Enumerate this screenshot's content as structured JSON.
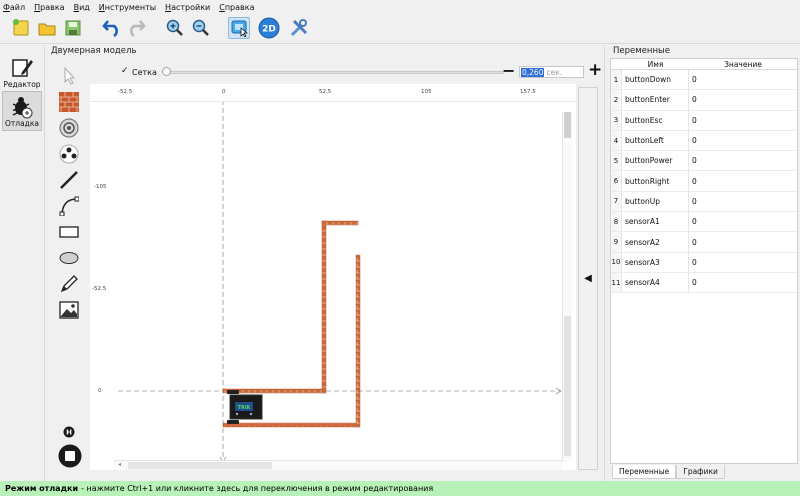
{
  "menu": [
    {
      "underline": "Ф",
      "rest": "айл"
    },
    {
      "underline": "П",
      "rest": "равка"
    },
    {
      "underline": "В",
      "rest": "ид"
    },
    {
      "underline": "И",
      "rest": "нструменты"
    },
    {
      "underline": "Н",
      "rest": "астройки"
    },
    {
      "underline": "С",
      "rest": "правка"
    }
  ],
  "toolbar": {
    "icons": [
      "new-file-icon",
      "open-folder-icon",
      "save-icon",
      "undo-icon",
      "redo-icon",
      "zoom-in-icon",
      "zoom-out-icon",
      "run-mode-icon",
      "view-2d-icon",
      "settings-tools-icon"
    ],
    "view_2d_label": "2D"
  },
  "modes": {
    "editor": "Редактор",
    "debug": "Отладка"
  },
  "scene": {
    "title": "Двумерная модель",
    "grid_label": "Сетка",
    "grid_checked": "✓",
    "minus": "−",
    "plus": "+",
    "time_value": "0,260",
    "time_unit": "сек.",
    "ruler_x": [
      "-52.5",
      "0",
      "52.5",
      "105",
      "157.5"
    ],
    "ruler_y": [
      "-105",
      "-52.5",
      "0"
    ],
    "robot_label": "TRIK"
  },
  "palette": [
    "cursor-icon",
    "wall-icon",
    "skittle-icon",
    "ball-icon",
    "line-icon",
    "bezier-icon",
    "rectangle-icon",
    "ellipse-icon",
    "pencil-icon",
    "image-icon"
  ],
  "variables": {
    "title": "Переменные",
    "col_name": "Имя",
    "col_value": "Значение",
    "rows": [
      {
        "idx": "1",
        "name": "buttonDown",
        "value": "0"
      },
      {
        "idx": "2",
        "name": "buttonEnter",
        "value": "0"
      },
      {
        "idx": "3",
        "name": "buttonEsc",
        "value": "0"
      },
      {
        "idx": "4",
        "name": "buttonLeft",
        "value": "0"
      },
      {
        "idx": "5",
        "name": "buttonPower",
        "value": "0"
      },
      {
        "idx": "6",
        "name": "buttonRight",
        "value": "0"
      },
      {
        "idx": "7",
        "name": "buttonUp",
        "value": "0"
      },
      {
        "idx": "8",
        "name": "sensorA1",
        "value": "0"
      },
      {
        "idx": "9",
        "name": "sensorA2",
        "value": "0"
      },
      {
        "idx": "10",
        "name": "sensorA3",
        "value": "0"
      },
      {
        "idx": "11",
        "name": "sensorA4",
        "value": "0"
      }
    ],
    "tabs": [
      "Переменные",
      "Графики"
    ]
  },
  "status": {
    "bold": "Режим отладки",
    "text": "- нажмите Ctrl+1 или кликните здесь для переключения в режим редактирования"
  }
}
